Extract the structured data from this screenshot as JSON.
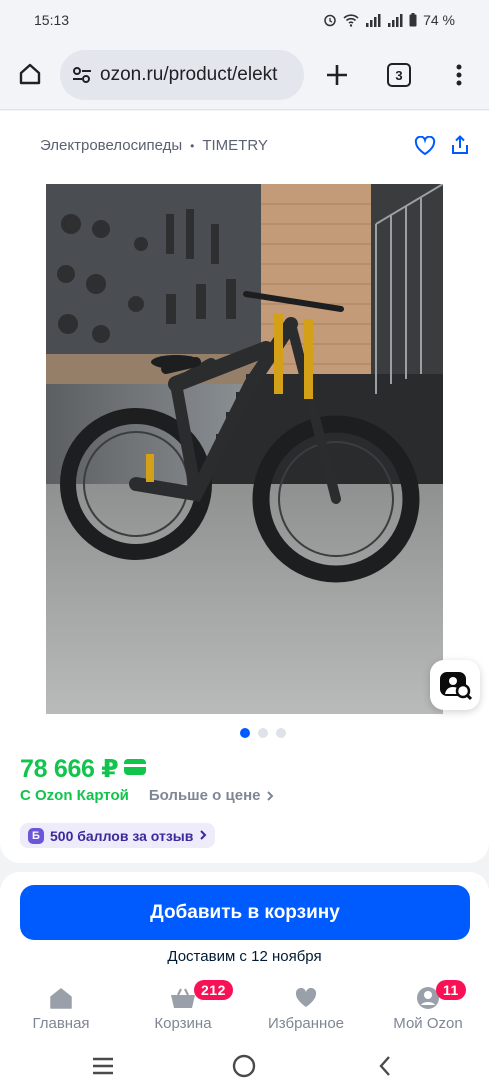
{
  "status_bar": {
    "time": "15:13",
    "battery": "74 %"
  },
  "browser": {
    "url": "ozon.ru/product/elekt",
    "tab_count": "3"
  },
  "breadcrumbs": {
    "category": "Электровелосипеды",
    "separator": "•",
    "brand": "TIMETRY"
  },
  "product": {
    "image_icon": "bicycle-photo",
    "carousel": {
      "total": 3,
      "active": 1
    },
    "price": "78 666 ₽",
    "card_label": "С Ozon Картой",
    "more_price": "Больше о цене",
    "points_icon_letter": "Б",
    "points_text": "500 баллов за отзыв"
  },
  "actions": {
    "add_to_cart": "Добавить в корзину",
    "delivery": "Доставим с 12 ноября"
  },
  "bottom_nav": {
    "items": [
      {
        "label": "Главная",
        "icon": "home-icon"
      },
      {
        "label": "Корзина",
        "icon": "basket-icon",
        "badge": "212"
      },
      {
        "label": "Избранное",
        "icon": "heart-icon"
      },
      {
        "label": "Мой Ozon",
        "icon": "profile-icon",
        "badge": "11"
      }
    ]
  },
  "colors": {
    "accent_blue": "#005bff",
    "price_green": "#10c44c",
    "badge_pink": "#f91155"
  }
}
